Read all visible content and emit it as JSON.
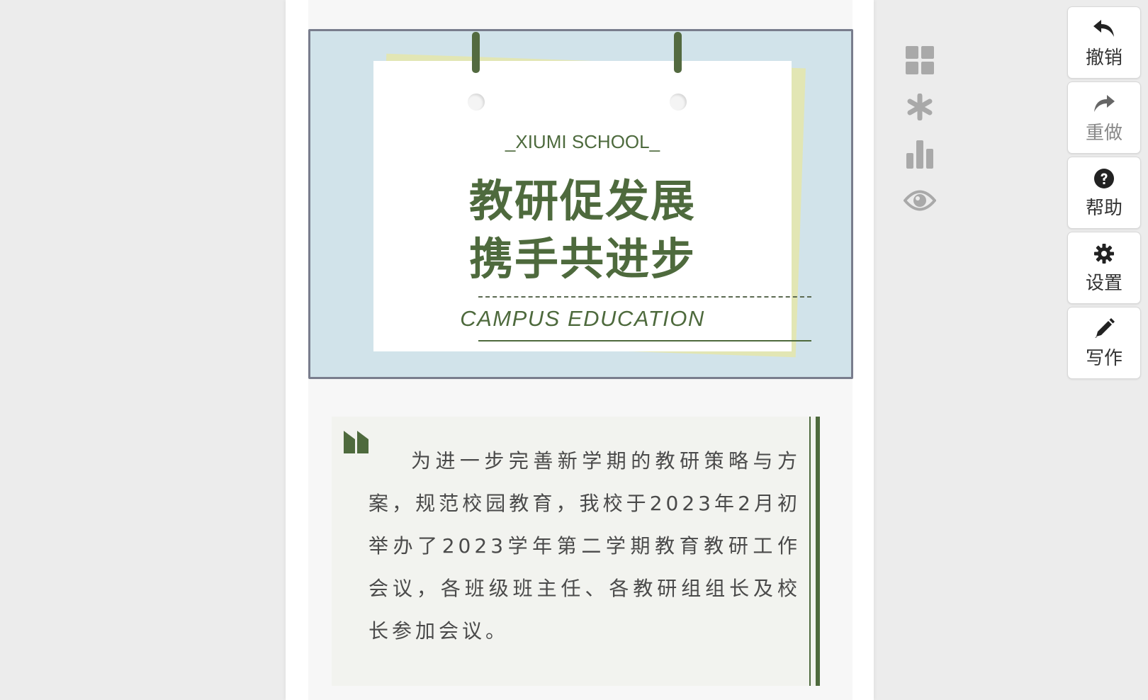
{
  "banner": {
    "school_tag": "_XIUMI SCHOOL_",
    "headline_line1": "教研促发展",
    "headline_line2": "携手共进步",
    "subtitle": "CAMPUS EDUCATION"
  },
  "quote": {
    "text": "为进一步完善新学期的教研策略与方案，规范校园教育，我校于2023年2月初举办了2023学年第二学期教育教研工作会议，各班级班主任、各教研组组长及校长参加会议。"
  },
  "side_icons": [
    "grid-icon",
    "asterisk-icon",
    "bar-chart-icon",
    "eye-icon"
  ],
  "toolbar": {
    "undo_label": "撤销",
    "redo_label": "重做",
    "help_label": "帮助",
    "settings_label": "设置",
    "write_label": "写作"
  },
  "colors": {
    "accent_green": "#4e6a3d",
    "banner_blue": "#d1e3ea",
    "paper_yellow": "#e2e6b4",
    "border_gray": "#797d8d"
  }
}
